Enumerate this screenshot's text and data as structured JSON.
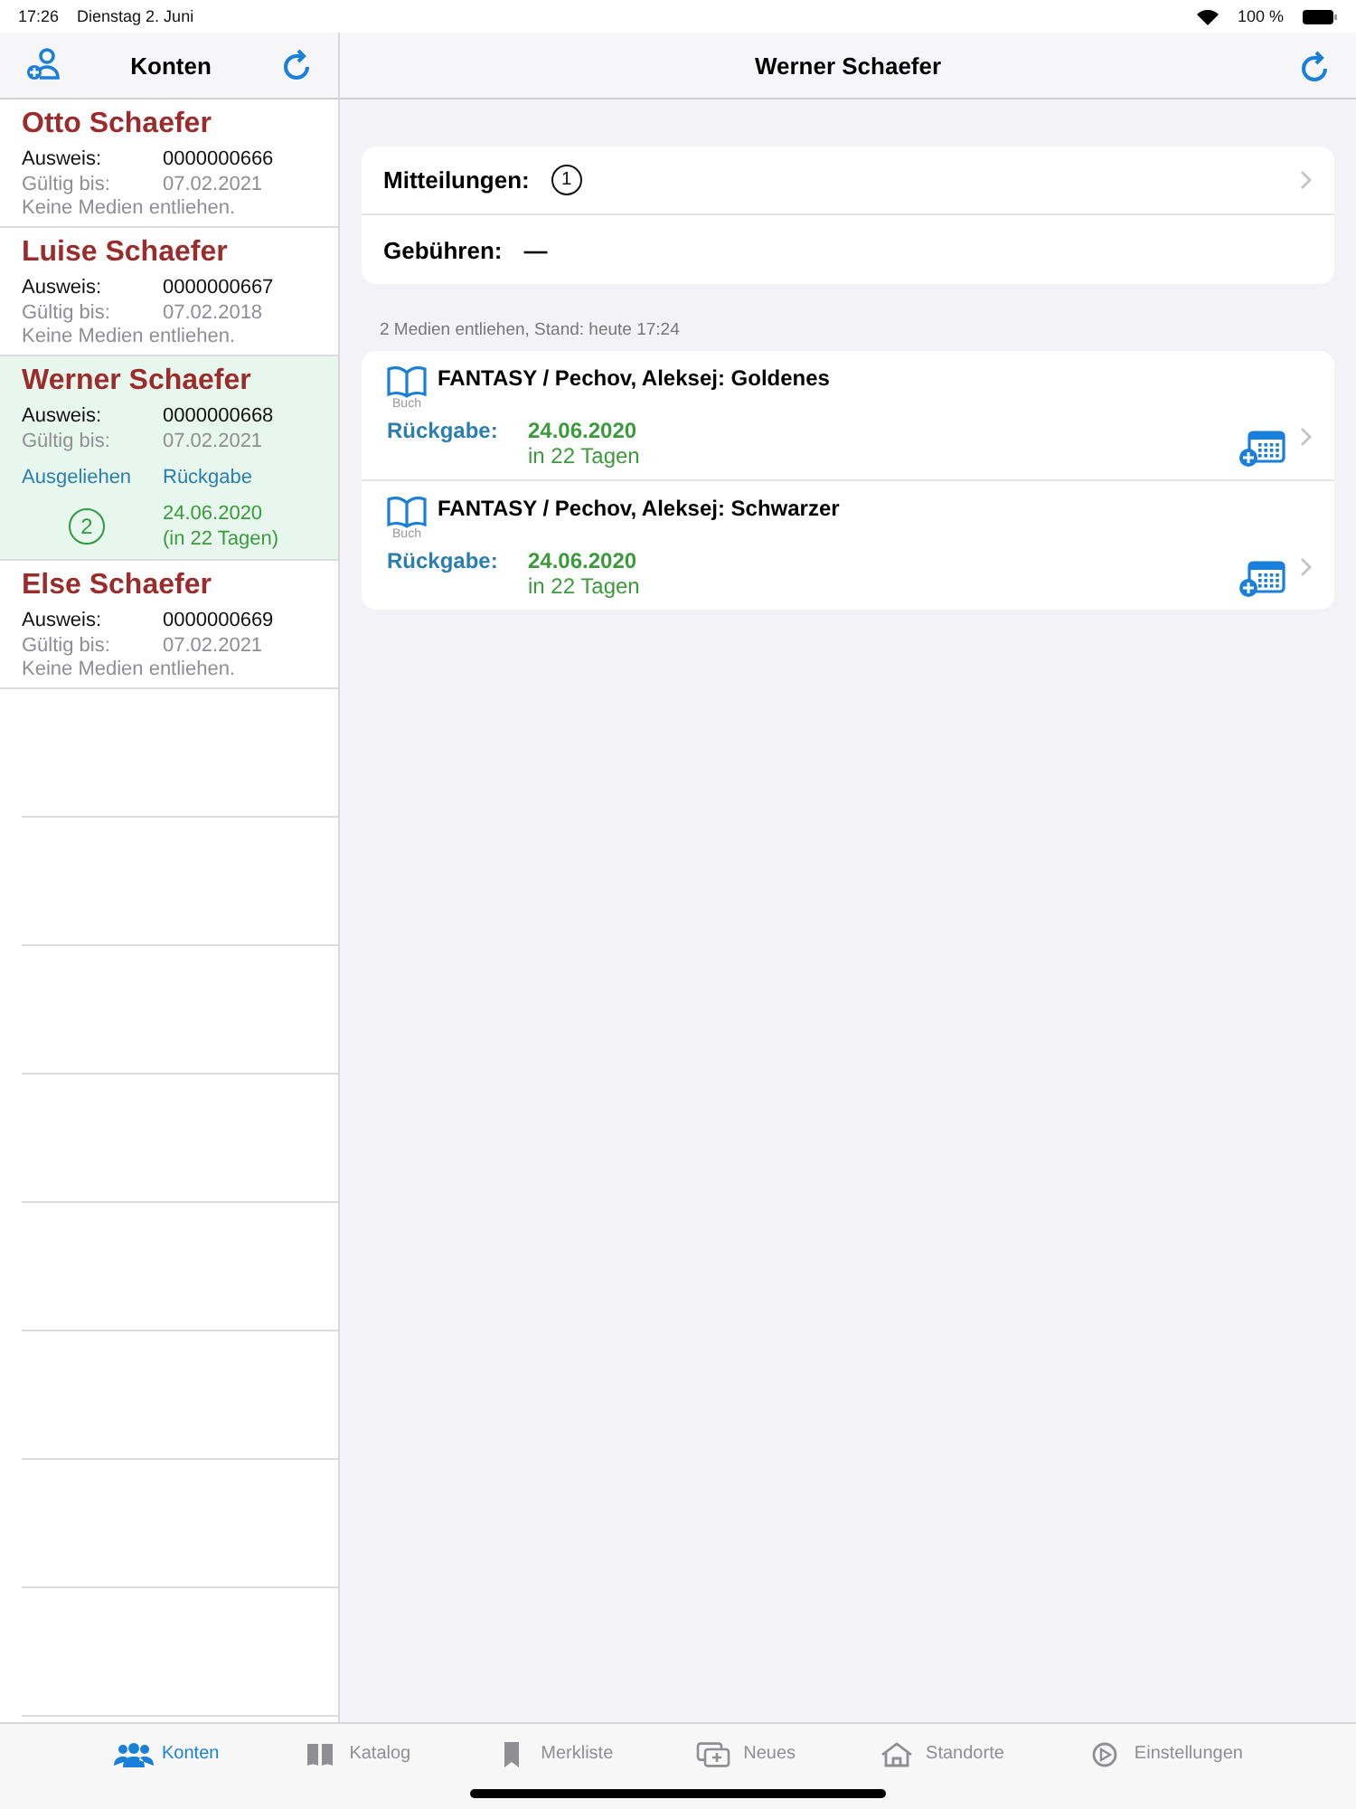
{
  "status_bar": {
    "time": "17:26",
    "date": "Dienstag 2. Juni",
    "battery": "100 %"
  },
  "sidebar": {
    "title": "Konten",
    "accounts": [
      {
        "name": "Otto Schaefer",
        "id_label": "Ausweis:",
        "id": "0000000666",
        "valid_label": "Gültig bis:",
        "valid": "07.02.2021",
        "selected": false,
        "note": "Keine Medien entliehen."
      },
      {
        "name": "Luise Schaefer",
        "id_label": "Ausweis:",
        "id": "0000000667",
        "valid_label": "Gültig bis:",
        "valid": "07.02.2018",
        "selected": false,
        "note": "Keine Medien entliehen."
      },
      {
        "name": "Werner Schaefer",
        "id_label": "Ausweis:",
        "id": "0000000668",
        "valid_label": "Gültig bis:",
        "valid": "07.02.2021",
        "selected": true,
        "loans": {
          "count_label": "Ausgeliehen",
          "return_label": "Rückgabe",
          "count": "2",
          "date": "24.06.2020",
          "days": "(in 22 Tagen)"
        }
      },
      {
        "name": "Else Schaefer",
        "id_label": "Ausweis:",
        "id": "0000000669",
        "valid_label": "Gültig bis:",
        "valid": "07.02.2021",
        "selected": false,
        "note": "Keine Medien entliehen."
      }
    ]
  },
  "detail": {
    "title": "Werner Schaefer",
    "messages": {
      "label": "Mitteilungen:",
      "count": "1"
    },
    "fees": {
      "label": "Gebühren:",
      "value": "—"
    },
    "loans_header": "2 Medien entliehen, Stand: heute 17:24",
    "loans": [
      {
        "title": "FANTASY / Pechov, Aleksej: Goldenes",
        "media": "Buch",
        "return_label": "Rückgabe:",
        "date": "24.06.2020",
        "days": "in 22 Tagen"
      },
      {
        "title": "FANTASY / Pechov, Aleksej: Schwarzer",
        "media": "Buch",
        "return_label": "Rückgabe:",
        "date": "24.06.2020",
        "days": "in 22 Tagen"
      }
    ]
  },
  "tabs": [
    {
      "label": "Konten",
      "selected": true
    },
    {
      "label": "Katalog",
      "selected": false
    },
    {
      "label": "Merkliste",
      "selected": false
    },
    {
      "label": "Neues",
      "selected": false
    },
    {
      "label": "Standorte",
      "selected": false
    },
    {
      "label": "Einstellungen",
      "selected": false
    }
  ]
}
